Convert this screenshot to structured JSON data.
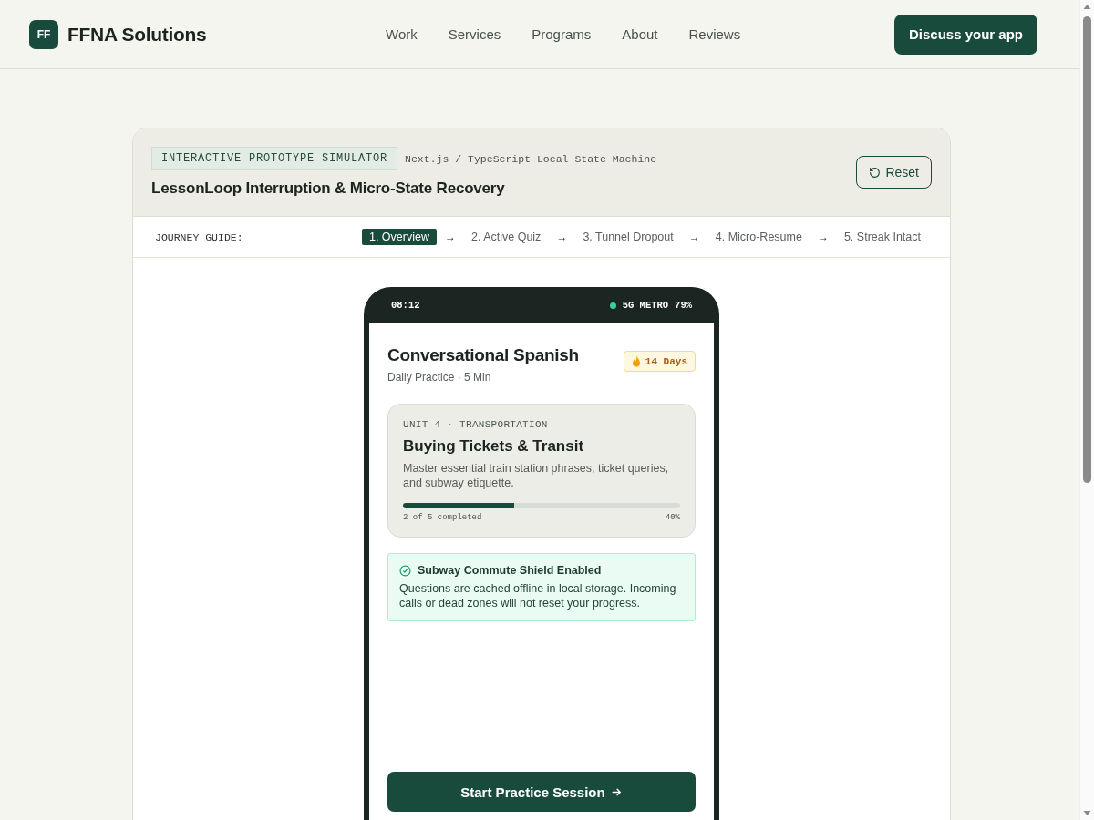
{
  "header": {
    "logo_mark": "FF",
    "brand": "FFNA Solutions",
    "nav": [
      "Work",
      "Services",
      "Programs",
      "About",
      "Reviews"
    ],
    "cta": "Discuss your app"
  },
  "simulator": {
    "tag": "INTERACTIVE PROTOTYPE SIMULATOR",
    "tech": "Next.js / TypeScript Local State Machine",
    "title": "LessonLoop Interruption & Micro-State Recovery",
    "reset": "Reset",
    "journey": {
      "label": "JOURNEY GUIDE:",
      "steps": [
        {
          "label": "1. Overview",
          "selected": true
        },
        {
          "label": "2. Active Quiz",
          "selected": false
        },
        {
          "label": "3. Tunnel Dropout",
          "selected": false
        },
        {
          "label": "4. Micro-Resume",
          "selected": false
        },
        {
          "label": "5. Streak Intact",
          "selected": false
        }
      ],
      "arrows": [
        "→",
        "→",
        "→",
        "→"
      ]
    }
  },
  "phone": {
    "status": {
      "time": "08:12",
      "network": "5G METRO",
      "battery": "79%"
    },
    "course": {
      "title": "Conversational Spanish",
      "subtitle": "Daily Practice · 5 Min",
      "streak": "14 Days"
    },
    "unit": {
      "eyebrow": "UNIT 4 · TRANSPORTATION",
      "title": "Buying Tickets & Transit",
      "description": "Master essential train station phrases, ticket queries, and subway etiquette.",
      "level": 0.4,
      "progress_text": "2 of 5 completed",
      "percent": "40%"
    },
    "notice": {
      "title": "Subway Commute Shield Enabled",
      "body": "Questions are cached offline in local storage. Incoming calls or dead zones will not reset your progress."
    },
    "start": "Start Practice Session"
  }
}
